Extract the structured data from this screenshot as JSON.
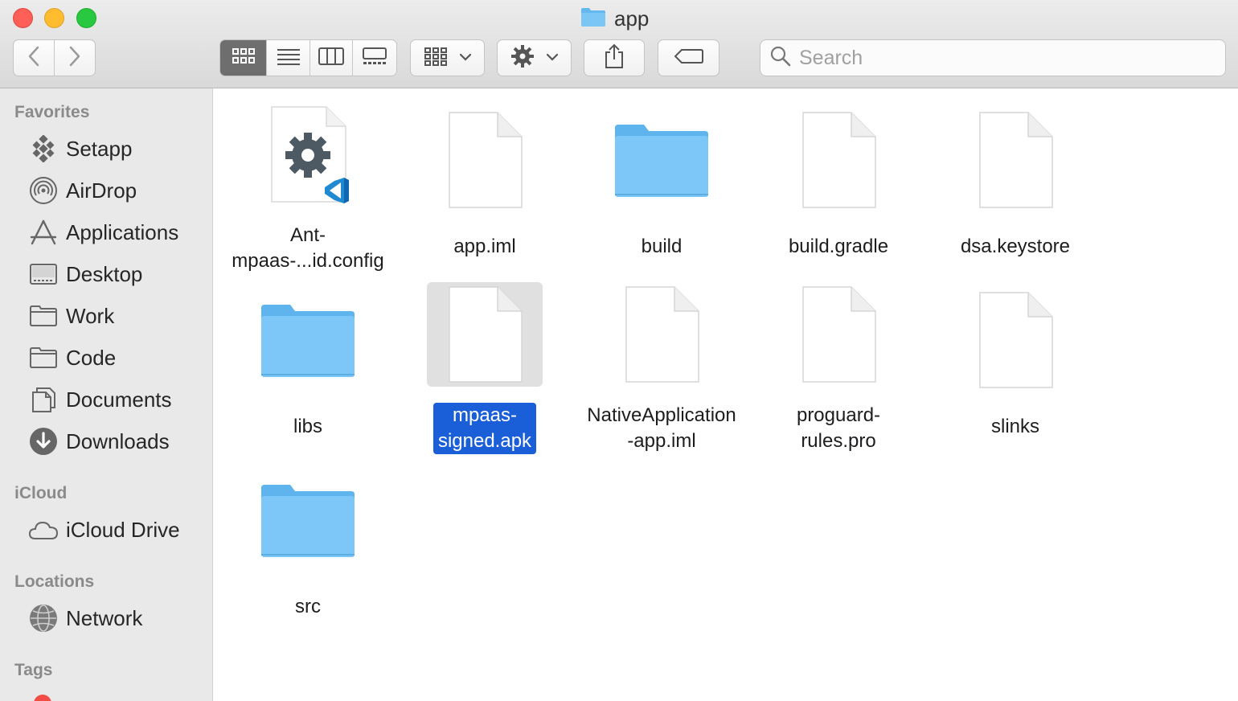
{
  "window": {
    "title": "app"
  },
  "toolbar": {
    "back_icon": "chevron-left-icon",
    "forward_icon": "chevron-right-icon",
    "view_modes": [
      "icon-view",
      "list-view",
      "column-view",
      "gallery-view"
    ],
    "active_view": "icon-view",
    "group_icon": "group-by-icon",
    "action_icon": "gear-icon",
    "share_icon": "share-icon",
    "tag_icon": "tag-icon",
    "search_placeholder": "Search"
  },
  "sidebar": {
    "favorites_label": "Favorites",
    "favorites": [
      {
        "label": "Setapp",
        "icon": "setapp-icon"
      },
      {
        "label": "AirDrop",
        "icon": "airdrop-icon"
      },
      {
        "label": "Applications",
        "icon": "applications-icon"
      },
      {
        "label": "Desktop",
        "icon": "desktop-icon"
      },
      {
        "label": "Work",
        "icon": "folder-icon"
      },
      {
        "label": "Code",
        "icon": "folder-icon"
      },
      {
        "label": "Documents",
        "icon": "documents-icon"
      },
      {
        "label": "Downloads",
        "icon": "downloads-icon"
      }
    ],
    "icloud_label": "iCloud",
    "icloud": [
      {
        "label": "iCloud Drive",
        "icon": "cloud-icon"
      }
    ],
    "locations_label": "Locations",
    "locations": [
      {
        "label": "Network",
        "icon": "network-icon"
      }
    ],
    "tags_label": "Tags"
  },
  "files": [
    {
      "name": "Ant-\nmpaas-...id.config",
      "type": "config"
    },
    {
      "name": "app.iml",
      "type": "document"
    },
    {
      "name": "build",
      "type": "folder"
    },
    {
      "name": "build.gradle",
      "type": "document"
    },
    {
      "name": "dsa.keystore",
      "type": "document"
    },
    {
      "name": "libs",
      "type": "folder"
    },
    {
      "name": "mpaas-\nsigned.apk",
      "type": "document",
      "selected": true
    },
    {
      "name": "NativeApplication\n-app.iml",
      "type": "document"
    },
    {
      "name": "proguard-\nrules.pro",
      "type": "document"
    },
    {
      "name": "slinks",
      "type": "document"
    },
    {
      "name": "src",
      "type": "folder"
    }
  ],
  "colors": {
    "selection": "#1a5fd8",
    "folder": "#5fb4ee",
    "close": "#fe5f57",
    "minimize": "#febc2e",
    "maximize": "#28c840"
  }
}
